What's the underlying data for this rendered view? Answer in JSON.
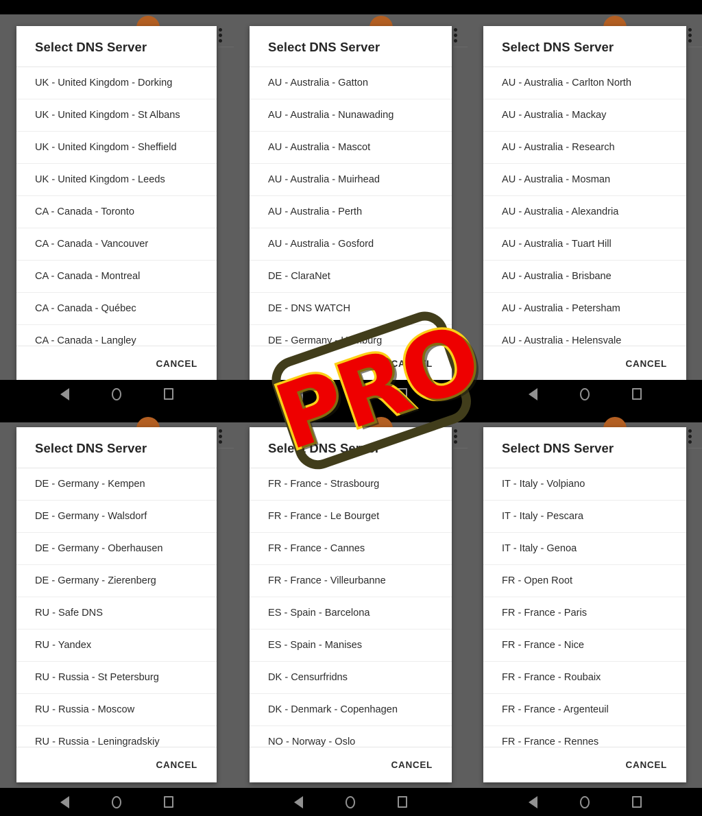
{
  "app": {
    "dialog_title": "Select DNS Server",
    "cancel_label": "CANCEL",
    "watermark": "PRO",
    "colors": {
      "scrim": "#5e5e5e",
      "dialog_bg": "#ffffff",
      "statusbar": "#000000",
      "navbar": "#000000",
      "watermark_fill": "#ee0000",
      "watermark_outline": "#fcd017",
      "watermark_frame": "#413d1b"
    }
  },
  "navbar": {
    "back_label": "back-button",
    "home_label": "home-button",
    "recents_label": "recents-button"
  },
  "panels": [
    {
      "id": "panel-1",
      "title": "Select DNS Server",
      "cancel": "CANCEL",
      "items": [
        "UK - United Kingdom - Dorking",
        "UK - United Kingdom - St Albans",
        "UK - United Kingdom - Sheffield",
        "UK - United Kingdom - Leeds",
        "CA - Canada - Toronto",
        "CA - Canada - Vancouver",
        "CA - Canada - Montreal",
        "CA - Canada - Québec",
        "CA - Canada - Langley"
      ]
    },
    {
      "id": "panel-2",
      "title": "Select DNS Server",
      "cancel": "CANCEL",
      "items": [
        "AU - Australia - Gatton",
        "AU - Australia - Nunawading",
        "AU - Australia - Mascot",
        "AU - Australia - Muirhead",
        "AU - Australia - Perth",
        "AU - Australia - Gosford",
        "DE - ClaraNet",
        "DE - DNS WATCH",
        "DE - Germany - Hamburg"
      ]
    },
    {
      "id": "panel-3",
      "title": "Select DNS Server",
      "cancel": "CANCEL",
      "items": [
        "AU - Australia - Carlton North",
        "AU - Australia - Mackay",
        "AU - Australia - Research",
        "AU - Australia - Mosman",
        "AU - Australia - Alexandria",
        "AU - Australia - Tuart Hill",
        "AU - Australia - Brisbane",
        "AU - Australia - Petersham",
        "AU - Australia - Helensvale"
      ]
    },
    {
      "id": "panel-4",
      "title": "Select DNS Server",
      "cancel": "CANCEL",
      "items": [
        "DE - Germany - Kempen",
        "DE - Germany - Walsdorf",
        "DE - Germany - Oberhausen",
        "DE - Germany - Zierenberg",
        "RU - Safe DNS",
        "RU - Yandex",
        "RU - Russia - St Petersburg",
        "RU - Russia - Moscow",
        "RU - Russia - Leningradskiy"
      ]
    },
    {
      "id": "panel-5",
      "title": "Select DNS Server",
      "cancel": "CANCEL",
      "items": [
        "FR - France - Strasbourg",
        "FR - France - Le Bourget",
        "FR - France - Cannes",
        "FR - France - Villeurbanne",
        "ES - Spain - Barcelona",
        "ES - Spain - Manises",
        "DK - Censurfridns",
        "DK - Denmark - Copenhagen",
        "NO - Norway - Oslo"
      ]
    },
    {
      "id": "panel-6",
      "title": "Select DNS Server",
      "cancel": "CANCEL",
      "items": [
        "IT - Italy - Volpiano",
        "IT - Italy - Pescara",
        "IT - Italy - Genoa",
        "FR - Open Root",
        "FR - France - Paris",
        "FR - France - Nice",
        "FR - France - Roubaix",
        "FR - France - Argenteuil",
        "FR - France - Rennes"
      ]
    }
  ]
}
